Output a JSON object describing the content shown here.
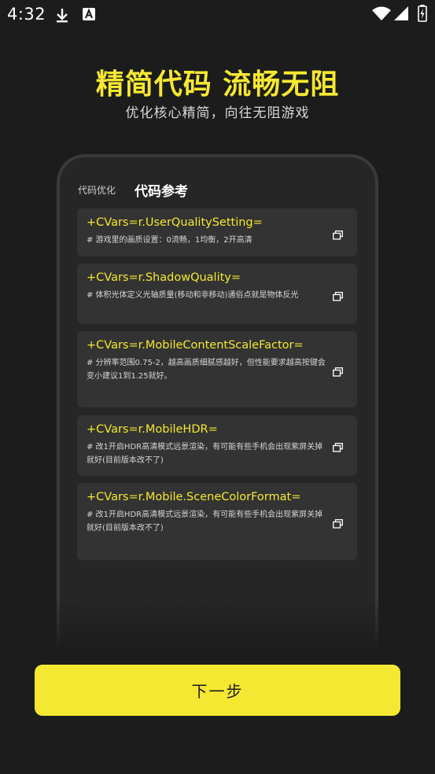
{
  "status_bar": {
    "time": "4:32"
  },
  "hero": {
    "title": "精简代码 流畅无阻",
    "subtitle": "优化核心精简，向往无阻游戏"
  },
  "tabs": {
    "inactive": "代码优化",
    "active": "代码参考"
  },
  "cards": [
    {
      "code": "+CVars=r.UserQualitySetting=",
      "desc": "# 游戏里的画质设置：0流畅，1均衡，2开高清"
    },
    {
      "code": "+CVars=r.ShadowQuality=",
      "desc": "# 体积光体定义光轴质量(移动和非移动)通俗点就是物体反光"
    },
    {
      "code": "+CVars=r.MobileContentScaleFactor=",
      "desc": "# 分辨率范围0.75-2，越高画质细腻感越好，但性能要求越高按键会变小建议1到1.25就好。"
    },
    {
      "code": "+CVars=r.MobileHDR=",
      "desc": "# 改1开启HDR高清模式远景渲染，有可能有些手机会出现紫屏关掉就好(目前版本改不了)"
    },
    {
      "code": "+CVars=r.Mobile.SceneColorFormat=",
      "desc": "# 改1开启HDR高清模式远景渲染，有可能有些手机会出现紫屏关掉就好(目前版本改不了)"
    }
  ],
  "next_button": {
    "label": "下一步"
  },
  "colors": {
    "accent": "#f5e832",
    "background": "#1c1c1c",
    "card": "#333333"
  }
}
